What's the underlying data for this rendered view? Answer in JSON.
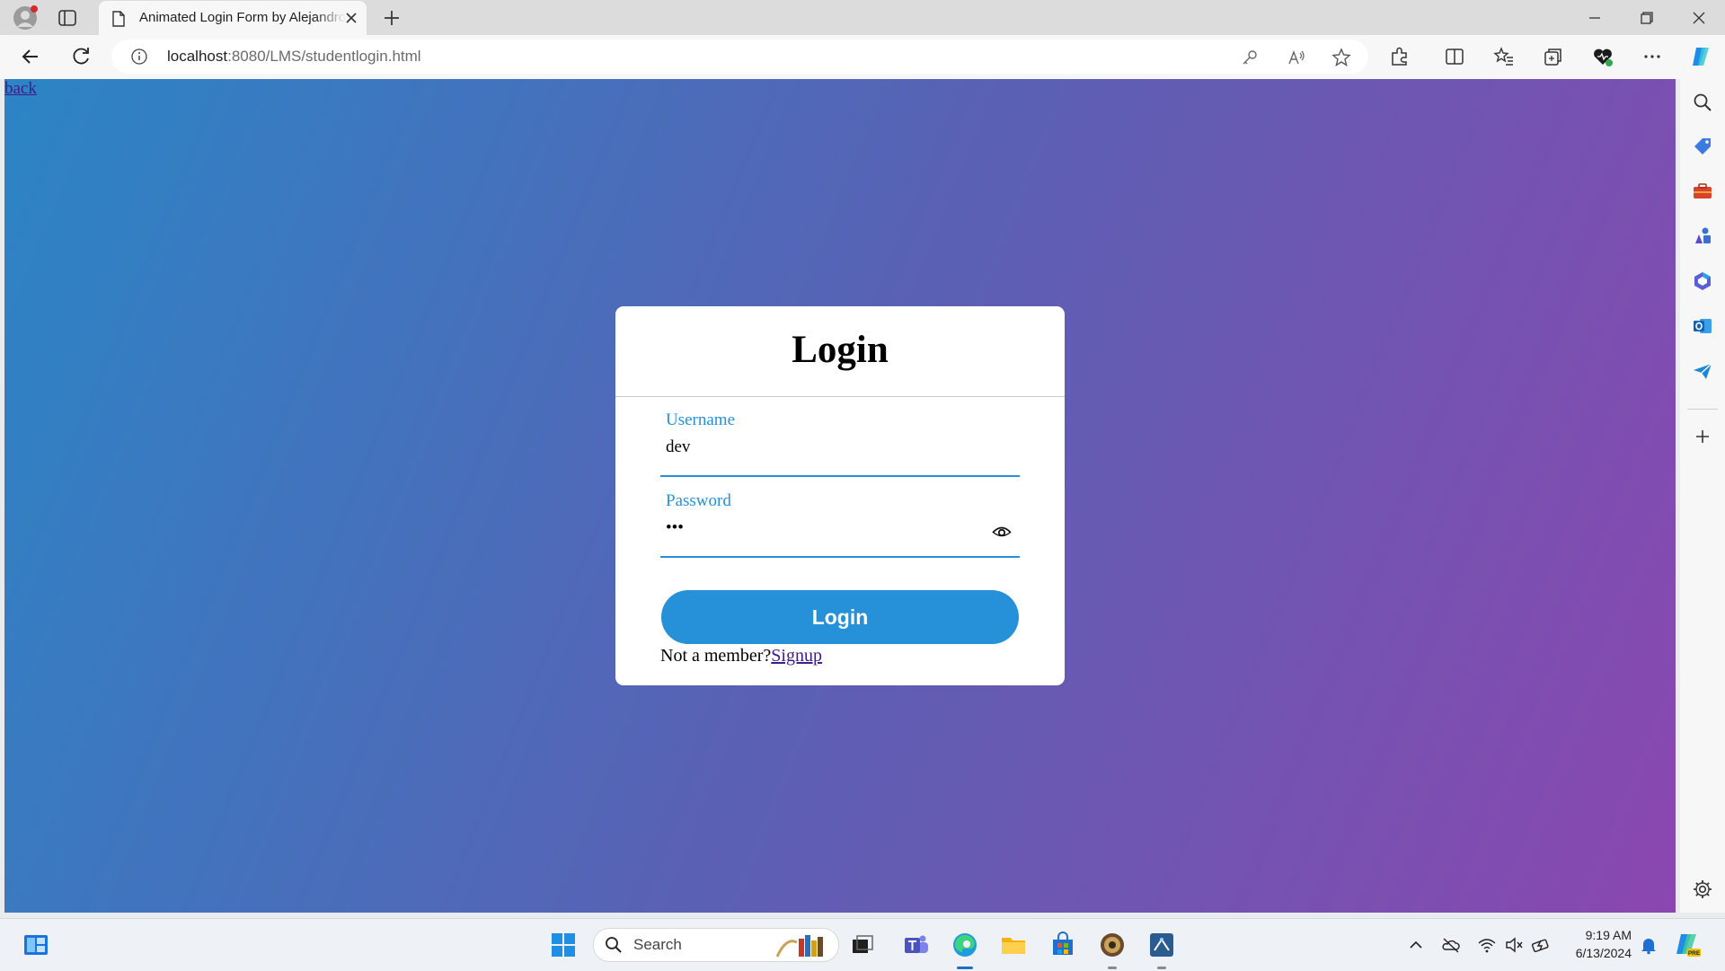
{
  "browser": {
    "tab_title": "Animated Login Form by Alejandro",
    "url_host": "localhost",
    "url_path": ":8080/LMS/studentlogin.html",
    "accent": "#2691d9"
  },
  "page": {
    "back_link": "back",
    "login_title": "Login",
    "username_label": "Username",
    "username_value": "dev",
    "password_label": "Password",
    "password_value": "•••",
    "login_button": "Login",
    "not_member_text": "Not a member?",
    "signup_link": "Signup"
  },
  "taskbar": {
    "search_placeholder": "Search",
    "time": "9:19 AM",
    "date": "6/13/2024"
  }
}
